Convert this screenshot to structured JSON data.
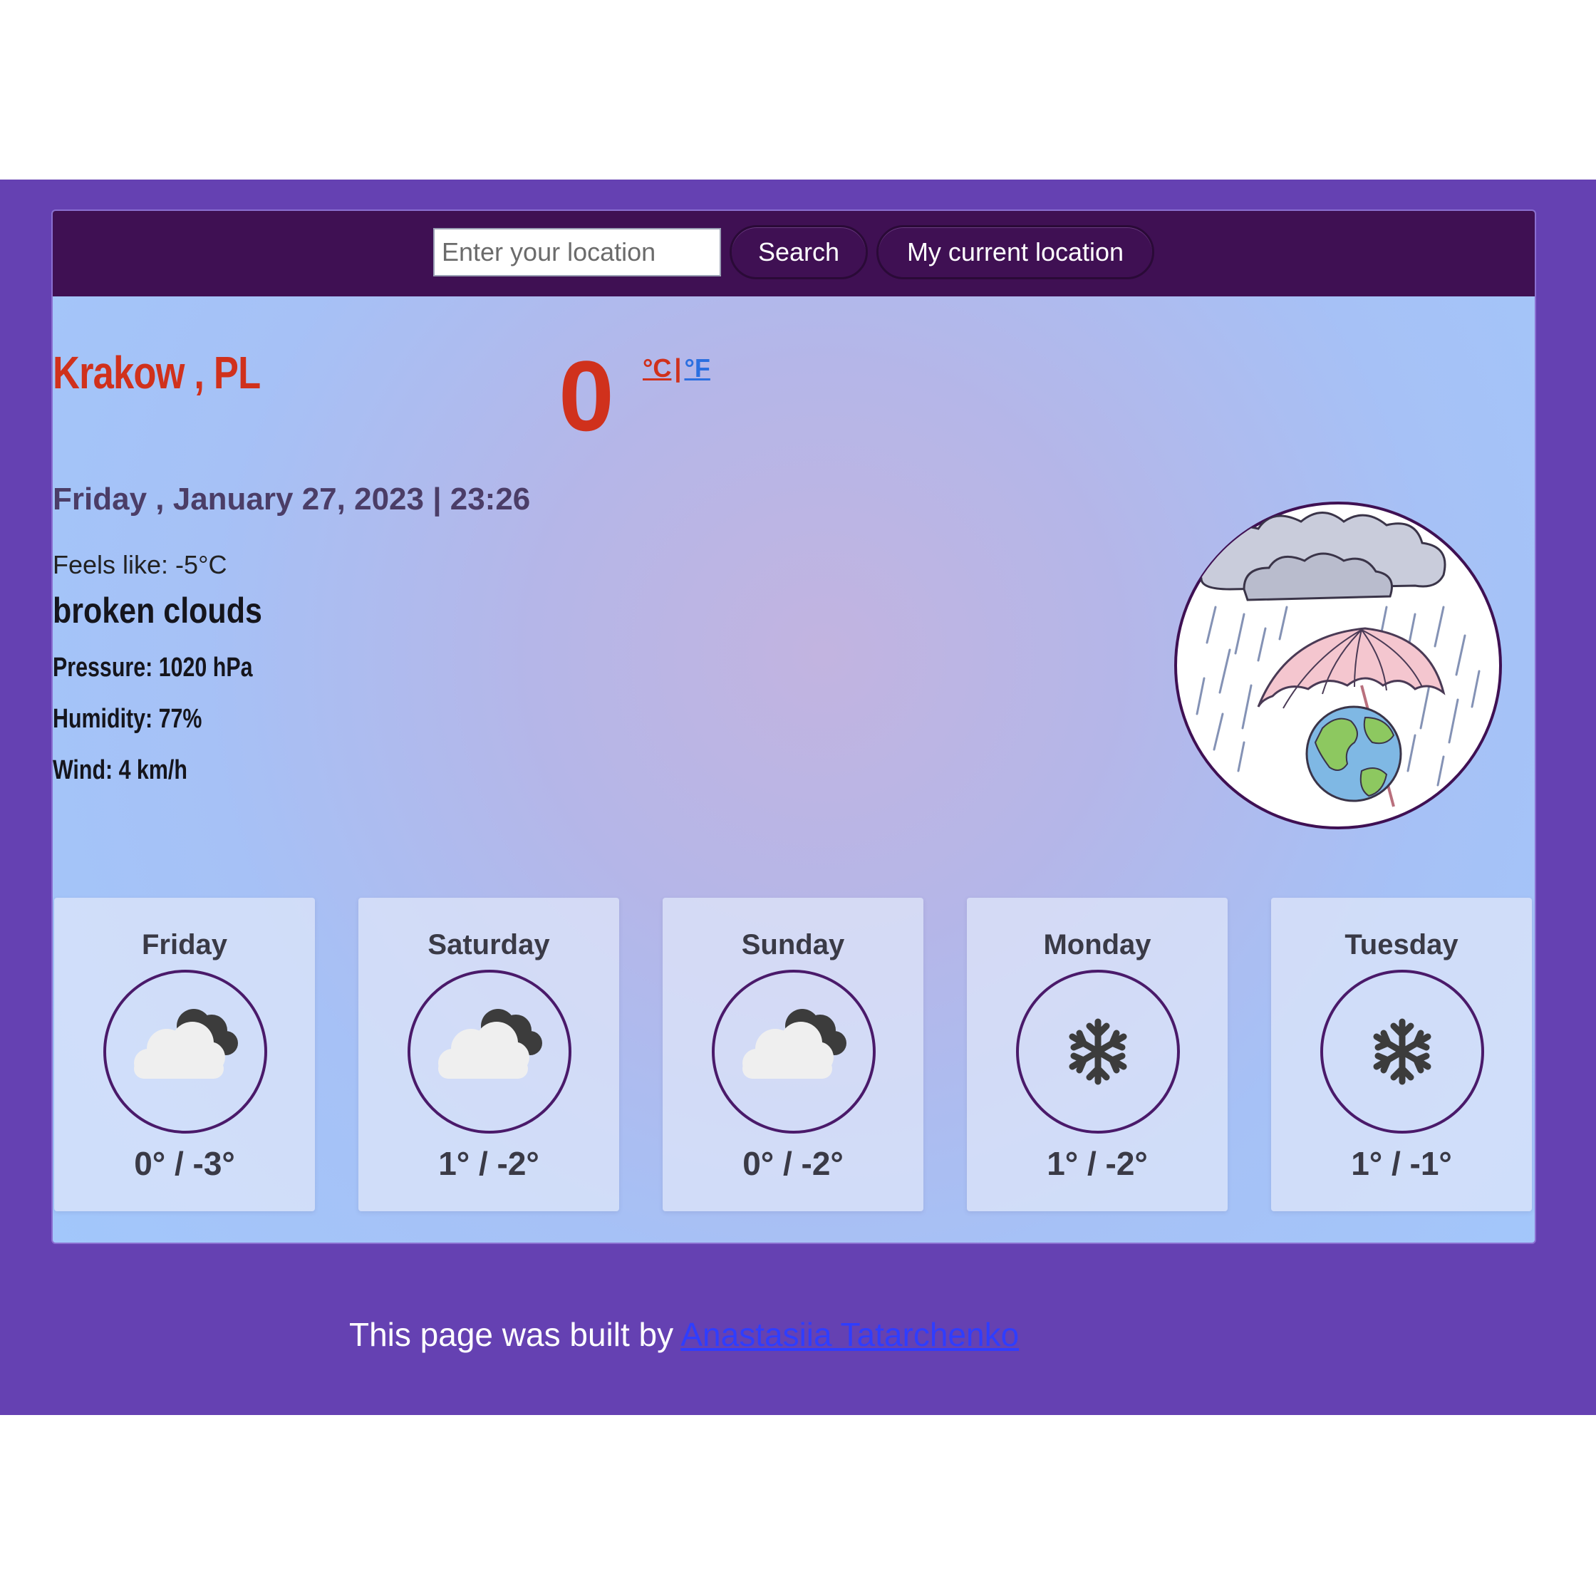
{
  "search": {
    "placeholder": "Enter your location",
    "search_label": "Search",
    "current_location_label": "My current location"
  },
  "current": {
    "city": "Krakow , PL",
    "temperature": "0",
    "unit_c": "°C",
    "unit_separator": "|",
    "unit_f": "°F",
    "datetime": "Friday , January 27, 2023 | 23:26",
    "feels_like": "Feels like: -5°C",
    "description": "broken clouds",
    "pressure": "Pressure: 1020 hPa",
    "humidity": "Humidity: 77%",
    "wind": "Wind: 4 km/h",
    "illustration_icon": "rain-umbrella-globe-illustration"
  },
  "forecast": [
    {
      "day": "Friday",
      "icon": "cloudy-icon",
      "temps": "0° / -3°"
    },
    {
      "day": "Saturday",
      "icon": "cloudy-icon",
      "temps": "1° / -2°"
    },
    {
      "day": "Sunday",
      "icon": "cloudy-icon",
      "temps": "0° / -2°"
    },
    {
      "day": "Monday",
      "icon": "snowflake-icon",
      "temps": "1° / -2°"
    },
    {
      "day": "Tuesday",
      "icon": "snowflake-icon",
      "temps": "1° / -1°"
    }
  ],
  "footer": {
    "prefix": "This page was built by ",
    "author": "Anastasiia Tatarchenko"
  },
  "colors": {
    "page_band": "#6541b2",
    "topbar": "#3f1053",
    "accent_red": "#d0311c",
    "link_blue": "#2f3dff"
  }
}
